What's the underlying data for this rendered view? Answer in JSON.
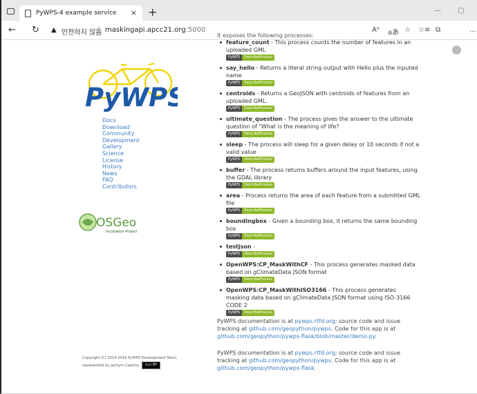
{
  "browser": {
    "tab_title": "PyWPS-4 example service",
    "tab_close": "×",
    "new_tab": "+",
    "warning_icon": "▲",
    "insecure_label": "안전하지 않음",
    "separator": "|",
    "url_host": "maskingapi.apcc21.org",
    "url_port": ":5000",
    "tools": [
      "Aᵃ",
      "aあ",
      "☆",
      "☆≡",
      "⧉",
      "…"
    ]
  },
  "sidebar": {
    "logo_text": "PyWPS",
    "nav": [
      "Docs",
      "Download",
      "Community",
      "Development",
      "Gallery",
      "Science",
      "License",
      "History",
      "News",
      "FAQ",
      "Contributors"
    ],
    "osgeo_text": "OSGeo",
    "osgeo_sub": "Incubation Project",
    "copyright_line1": "Copyright (C) 2014-2016 PyWPS Development Team,",
    "copyright_line2": "represented by Jachym Cepicky.",
    "cc_badge": "(cc) BY"
  },
  "main": {
    "intro": "It exposes the following processes:",
    "badge_left": "PyWPS",
    "badge_right": "DescribeProcess",
    "processes": [
      {
        "name": "feature_count",
        "desc": " - This process counts the number of features in an uploaded GML"
      },
      {
        "name": "say_hello",
        "desc": " - Returns a literal string output with Hello plus the inputed name"
      },
      {
        "name": "centroids",
        "desc": " - Returns a GeoJSON with centroids of features from an uploaded GML."
      },
      {
        "name": "ultimate_question",
        "desc": " - The process gives the answer to the ultimate question of \"What is the meaning of life?"
      },
      {
        "name": "sleep",
        "desc": " - The process will sleep for a given delay or 10 seconds if not a valid value"
      },
      {
        "name": "buffer",
        "desc": " - The process returns buffers around the input features, using the GDAL library"
      },
      {
        "name": "area",
        "desc": " - Process returns the area of each feature from a submitted GML file"
      },
      {
        "name": "boundingbox",
        "desc": " - Given a bounding box, it returns the same bounding box"
      },
      {
        "name": "testjson",
        "desc": " -"
      },
      {
        "name": "OpenWPS:CP_MaskWithCF",
        "desc": " - This process generates masked data based on gClimateData JSON format"
      },
      {
        "name": "OpenWPS:CP_MaskWithISO3166",
        "desc": " - This process generates masking data based on gClimateData JSON format using ISO-3166 CODE 2"
      }
    ],
    "doc1": {
      "t1": "PyWPS documentation is at ",
      "l1": "pywps.rtfd.org",
      "t2": "; source code and issue tracking at ",
      "l2": "github.com/geopython/pywps",
      "t3": ". Code for this app is at ",
      "l3": "github.com/geopython/pywps-flask/blob/master/demo.py",
      "t4": "."
    },
    "doc2": {
      "t1": "PyWPS documentation is at ",
      "l1": "pywps.rtfd.org",
      "t2": "; source code and issue tracking at ",
      "l2": "github.com/geopython/pywps",
      "t3": ". Code for this app is at ",
      "l3": "github.com/geopython/pywps-flask",
      "t4": "."
    }
  }
}
